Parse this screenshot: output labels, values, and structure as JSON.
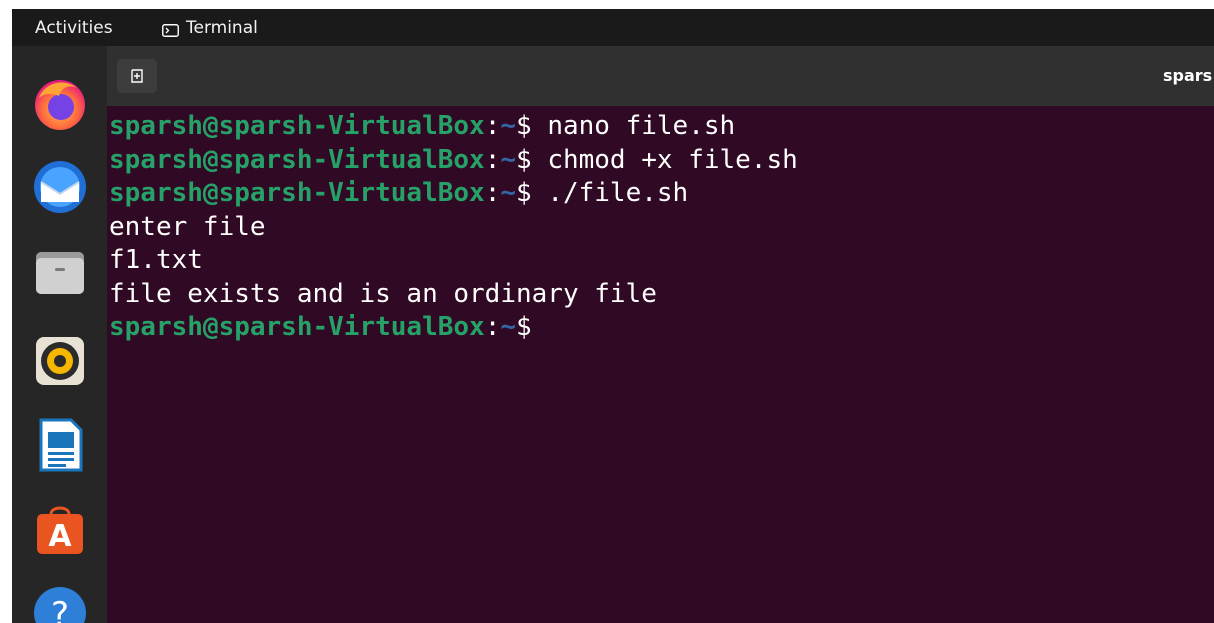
{
  "topbar": {
    "activities_label": "Activities",
    "app_name": "Terminal"
  },
  "terminal": {
    "window_title": "spars",
    "prompt_user": "sparsh@sparsh-VirtualBox",
    "prompt_sep": ":",
    "prompt_path": "~",
    "prompt_symbol": "$ ",
    "lines": [
      {
        "type": "prompt",
        "command": "nano file.sh"
      },
      {
        "type": "prompt",
        "command": "chmod +x file.sh"
      },
      {
        "type": "prompt",
        "command": "./file.sh"
      },
      {
        "type": "output",
        "text": "enter file"
      },
      {
        "type": "output",
        "text": "f1.txt"
      },
      {
        "type": "output",
        "text": "file exists and is an ordinary file"
      },
      {
        "type": "prompt",
        "command": ""
      }
    ],
    "colors": {
      "background": "#300a24",
      "prompt_user": "#26a269",
      "prompt_path": "#3465a4"
    }
  },
  "dock": {
    "items": [
      {
        "name": "firefox-icon"
      },
      {
        "name": "thunderbird-icon"
      },
      {
        "name": "files-icon"
      },
      {
        "name": "rhythmbox-icon"
      },
      {
        "name": "libreoffice-writer-icon"
      },
      {
        "name": "ubuntu-software-icon",
        "glyph": "A"
      },
      {
        "name": "help-icon",
        "glyph": "?"
      }
    ]
  }
}
